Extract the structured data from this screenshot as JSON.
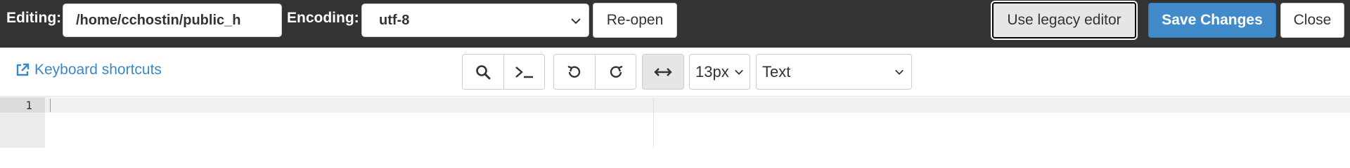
{
  "header": {
    "editing_label": "Editing:",
    "path_value": "/home/cchostin/public_h",
    "encoding_label": "Encoding:",
    "encoding_value": "utf-8",
    "reopen_label": "Re-open",
    "legacy_label": "Use legacy editor",
    "save_label": "Save Changes",
    "close_label": "Close"
  },
  "toolbar": {
    "shortcuts_label": "Keyboard shortcuts",
    "font_size": "13px",
    "mode": "Text",
    "icons": [
      "search-icon",
      "terminal-icon",
      "undo-icon",
      "redo-icon",
      "wrap-icon"
    ]
  },
  "editor": {
    "line_numbers": [
      "1"
    ]
  },
  "colors": {
    "topbar": "#333333",
    "primary": "#428bca",
    "link": "#3a87c8"
  }
}
